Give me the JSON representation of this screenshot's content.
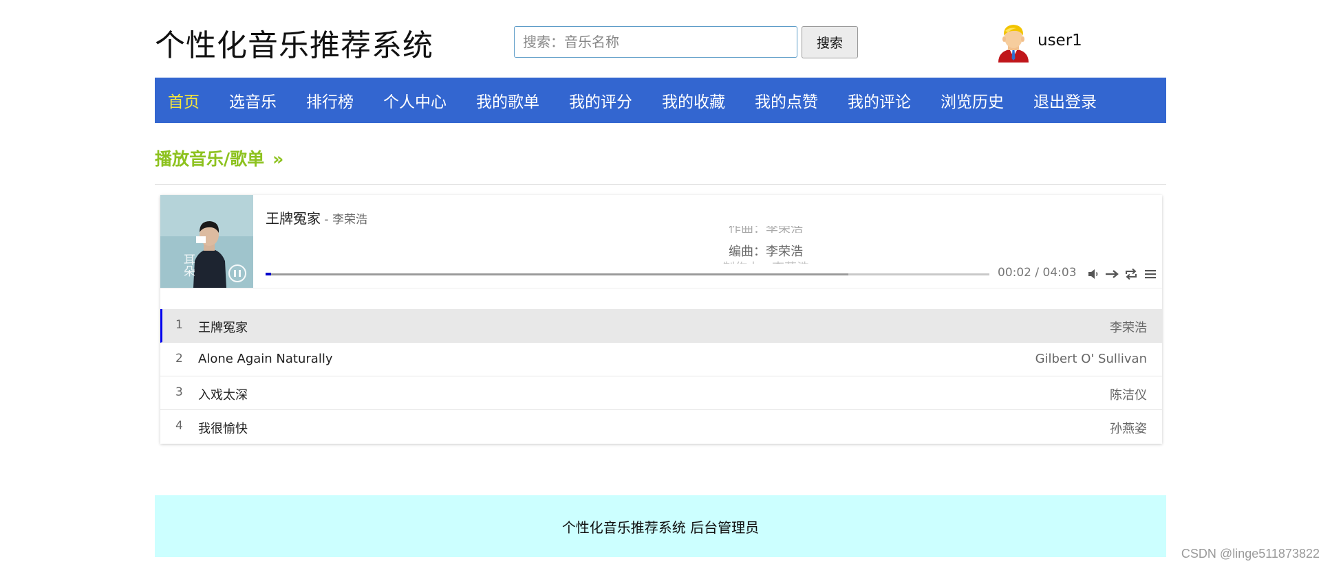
{
  "header": {
    "site_title": "个性化音乐推荐系统",
    "search_placeholder": "搜索：音乐名称",
    "search_button": "搜索",
    "username": "user1"
  },
  "nav": {
    "items": [
      "首页",
      "选音乐",
      "排行榜",
      "个人中心",
      "我的歌单",
      "我的评分",
      "我的收藏",
      "我的点赞",
      "我的评论",
      "浏览历史",
      "退出登录"
    ],
    "active_index": 0
  },
  "section": {
    "title": "播放音乐/歌单",
    "arrow": "»"
  },
  "player": {
    "song_title": "王牌冤家",
    "song_artist": " - 李荣浩",
    "lyric_prev": "作曲：李荣浩",
    "lyric_current": "编曲：李荣浩",
    "lyric_next": "制作人：李荣浩",
    "time": "00:02 / 04:03",
    "progress_played_fraction": 0.008,
    "progress_loaded_fraction": 0.805,
    "cover_text": "耳朵"
  },
  "playlist": [
    {
      "num": "1",
      "name": "王牌冤家",
      "artist": "李荣浩",
      "active": true
    },
    {
      "num": "2",
      "name": "Alone Again Naturally",
      "artist": "Gilbert O' Sullivan",
      "active": false
    },
    {
      "num": "3",
      "name": "入戏太深",
      "artist": "陈洁仪",
      "active": false
    },
    {
      "num": "4",
      "name": "我很愉快",
      "artist": "孙燕姿",
      "active": false
    }
  ],
  "footer": {
    "text": "个性化音乐推荐系统 后台管理员"
  },
  "watermark": "CSDN @linge511873822",
  "colors": {
    "nav_bg": "#3366d0",
    "nav_active": "#f5e63a",
    "section_title": "#8dc21f",
    "footer_bg": "#ccffff",
    "active_marker": "#0000ee"
  }
}
